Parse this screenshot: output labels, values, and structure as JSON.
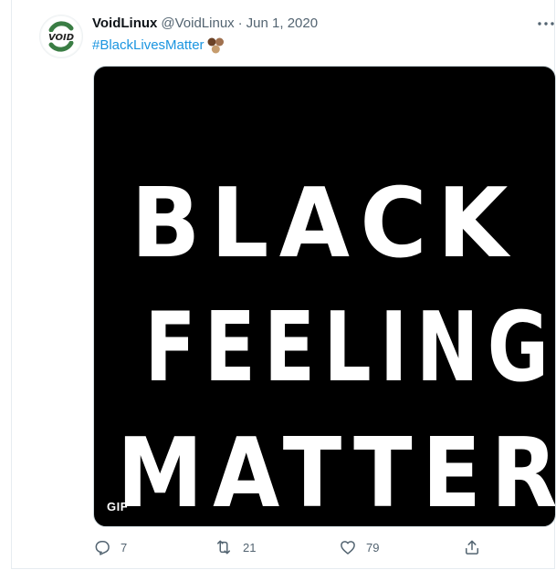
{
  "tweet": {
    "display_name": "VoidLinux",
    "handle": "@VoidLinux",
    "separator": "·",
    "date": "Jun 1, 2020",
    "hashtag": "#BlackLivesMatter",
    "emoji_icon": "brown-circles-emoji-icon",
    "avatar_logo_text": "VOID"
  },
  "media": {
    "lines": [
      "BLACK",
      "FEELINGS",
      "MATTER"
    ],
    "badge": "GIF"
  },
  "actions": {
    "reply_count": "7",
    "retweet_count": "21",
    "like_count": "79"
  },
  "colors": {
    "link": "#1b95e0",
    "muted": "#536471",
    "text": "#0f1419",
    "logo_green": "#3a7d44"
  }
}
